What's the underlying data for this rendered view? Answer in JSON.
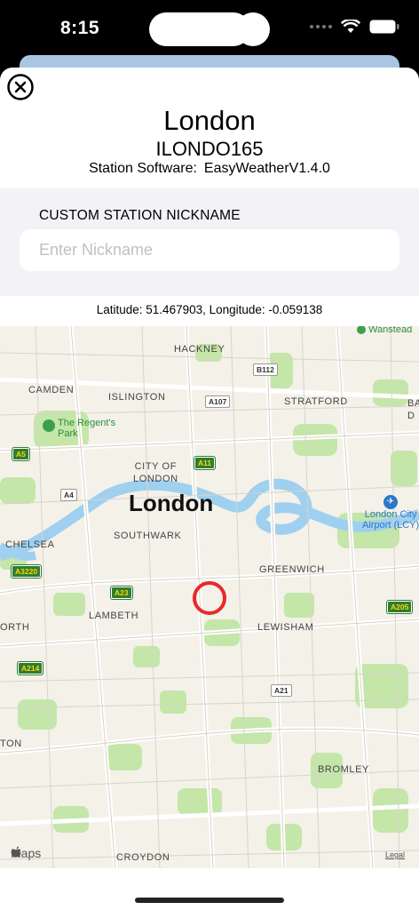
{
  "status_bar": {
    "time": "8:15"
  },
  "header": {
    "title": "London",
    "station_id": "ILONDO165",
    "software_label": "Station Software:",
    "software_value": "EasyWeatherV1.4.0"
  },
  "nickname": {
    "section_header": "CUSTOM STATION NICKNAME",
    "placeholder": "Enter Nickname",
    "value": ""
  },
  "location": {
    "coords_text": "Latitude: 51.467903, Longitude: -0.059138"
  },
  "map": {
    "labels": {
      "hackney": "HACKNEY",
      "camden": "CAMDEN",
      "islington": "ISLINGTON",
      "stratford": "STRATFORD",
      "city": "CITY OF\nLONDON",
      "london": "London",
      "southwark": "SOUTHWARK",
      "chelsea": "CHELSEA",
      "greenwich": "GREENWICH",
      "lambeth": "LAMBETH",
      "lewisham": "LEWISHAM",
      "north": "ORTH",
      "ton": "TON",
      "bromley": "BROMLEY",
      "croydon": "CROYDON",
      "ba": "BA\nD",
      "regents_park": "The Regent's\nPark",
      "airport": "London City\nAirport (LCY)",
      "wanstead": "Wanstead"
    },
    "roads": {
      "b112": "B112",
      "a107": "A107",
      "a5": "A5",
      "a11": "A11",
      "a4": "A4",
      "a3220": "A3220",
      "a23": "A23",
      "a205": "A205",
      "a214": "A214",
      "a21": "A21"
    },
    "attribution": "Maps",
    "legal": "Legal"
  },
  "colors": {
    "marker": "#e8292b",
    "water": "#9fd0ef",
    "park": "#bfe3a3",
    "road_shield_green": "#2e7d32"
  }
}
